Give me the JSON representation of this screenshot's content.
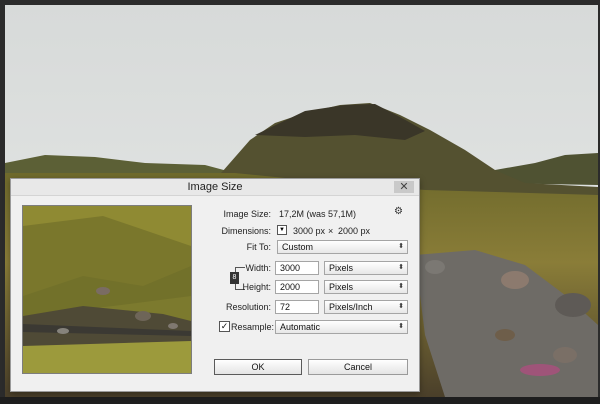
{
  "dialog": {
    "title": "Image Size",
    "close_label": "✕",
    "image_size_label": "Image Size:",
    "image_size_value": "17,2M (was 57,1M)",
    "dimensions_label": "Dimensions:",
    "dimensions_width": "3000 px",
    "dimensions_sep": "×",
    "dimensions_height": "2000 px",
    "fit_to_label": "Fit To:",
    "fit_to_value": "Custom",
    "width_label": "Width:",
    "width_value": "3000",
    "width_unit": "Pixels",
    "height_label": "Height:",
    "height_value": "2000",
    "height_unit": "Pixels",
    "resolution_label": "Resolution:",
    "resolution_value": "72",
    "resolution_unit": "Pixels/Inch",
    "resample_label": "Resample:",
    "resample_checked": true,
    "resample_value": "Automatic",
    "ok_label": "OK",
    "cancel_label": "Cancel"
  },
  "icons": {
    "gear": "⚙",
    "dropdown": "▼",
    "check": "✓",
    "link": "8"
  }
}
